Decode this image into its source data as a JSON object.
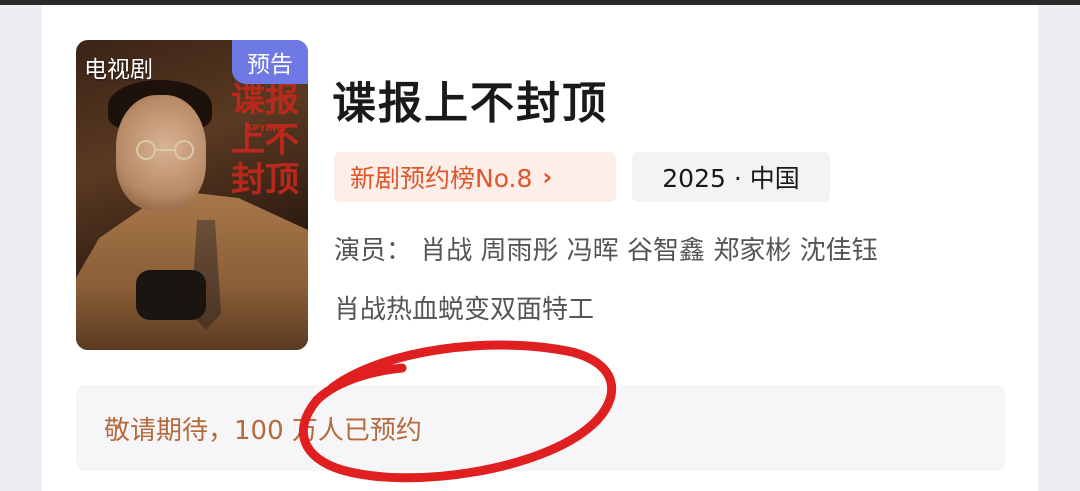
{
  "poster": {
    "category_tag": "电视剧",
    "preview_tag": "预告",
    "title_art": "谍报上不封顶",
    "title_art_en": "SPYING"
  },
  "show": {
    "title": "谍报上不封顶",
    "rank_label": "新剧预约榜No.8",
    "rank_chevron": "›",
    "year_region": "2025 · 中国",
    "cast": "演员： 肖战 周雨彤 冯晖 谷智鑫 郑家彬 沈佳钰",
    "description": "肖战热血蜕变双面特工"
  },
  "reservation": {
    "text": "敬请期待，100 万人已预约"
  },
  "colors": {
    "preview_tag_bg": "#6f79e6",
    "rank_text": "#e0562c",
    "rank_bg": "#fdefe8",
    "reserve_text": "#b56a3c",
    "circle_annotation": "#e02020"
  }
}
